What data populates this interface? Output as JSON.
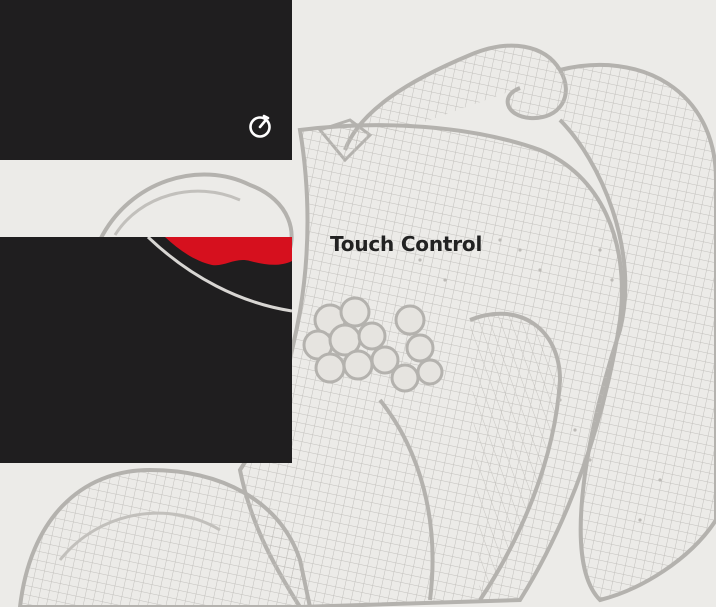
{
  "feature": {
    "heading": "Touch Control"
  },
  "icons": {
    "timer": "timer-icon"
  },
  "colors": {
    "background": "#ecebe8",
    "panel": "#1f1e1f",
    "sketch": "#b4b2ae",
    "accent_red": "#d6101e",
    "heading_text": "#222222"
  }
}
